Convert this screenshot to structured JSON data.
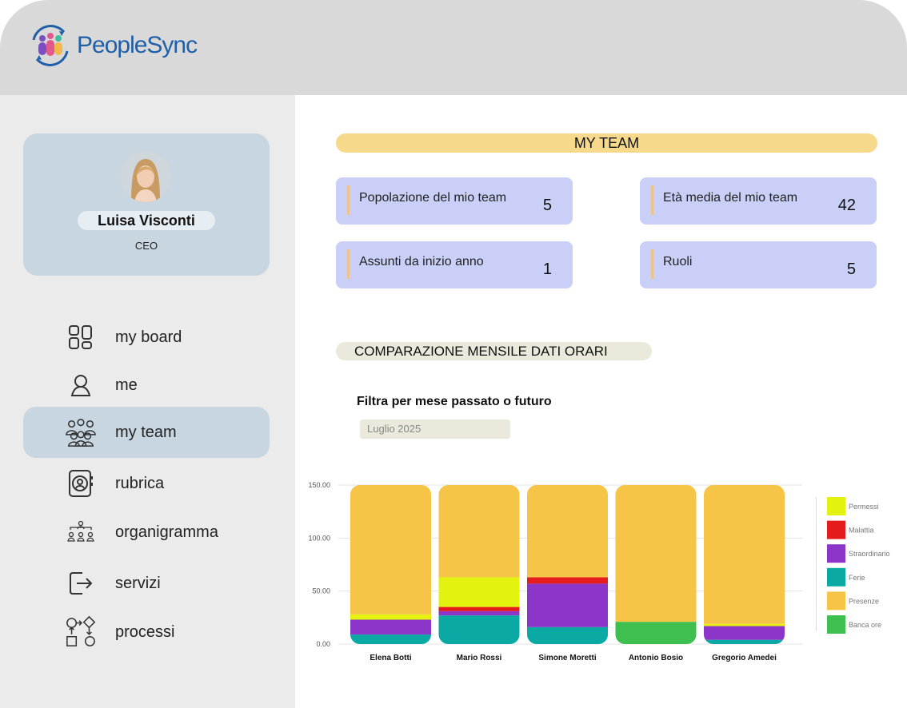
{
  "app": {
    "brand": "PeopleSync"
  },
  "profile": {
    "name": "Luisa Visconti",
    "role": "CEO"
  },
  "nav": [
    {
      "label": "my board",
      "icon": "grid-icon"
    },
    {
      "label": "me",
      "icon": "user-icon"
    },
    {
      "label": "my team",
      "icon": "team-icon",
      "active": true
    },
    {
      "label": "rubrica",
      "icon": "contact-book-icon"
    },
    {
      "label": "organigramma",
      "icon": "org-chart-icon"
    },
    {
      "label": "servizi",
      "icon": "exit-icon"
    },
    {
      "label": "processi",
      "icon": "flow-icon"
    }
  ],
  "team": {
    "title": "MY TEAM",
    "stats": [
      {
        "label": "Popolazione del mio team",
        "value": "5"
      },
      {
        "label": "Età media del mio team",
        "value": "42"
      },
      {
        "label": "Assunti da inizio anno",
        "value": "1"
      },
      {
        "label": "Ruoli",
        "value": "5"
      }
    ]
  },
  "comparison": {
    "title": "COMPARAZIONE MENSILE DATI ORARI",
    "filter_title": "Filtra per mese passato o futuro",
    "filter_value": "Luglio 2025"
  },
  "chart_data": {
    "type": "bar",
    "stacked": true,
    "categories": [
      "Elena Botti",
      "Mario Rossi",
      "Simone Moretti",
      "Antonio Bosio",
      "Gregorio Amedei"
    ],
    "ylim": [
      0,
      150
    ],
    "yticks": [
      "0.00",
      "50.00",
      "100.00",
      "150.00"
    ],
    "grid": true,
    "legend": "right",
    "series": [
      {
        "name": "Banca ore",
        "color": "#3fbf4f",
        "values": [
          0,
          0,
          0,
          21,
          0
        ]
      },
      {
        "name": "Ferie",
        "color": "#0aa9a3",
        "values": [
          9,
          27,
          16,
          0,
          4
        ]
      },
      {
        "name": "Straordinario",
        "color": "#8b35c9",
        "values": [
          14,
          4,
          41,
          0,
          13
        ]
      },
      {
        "name": "Malattia",
        "color": "#e51c1c",
        "values": [
          0,
          4,
          6,
          0,
          0
        ]
      },
      {
        "name": "Permessi",
        "color": "#e3f30f",
        "values": [
          5,
          28,
          0,
          0,
          2
        ]
      },
      {
        "name": "Presenze",
        "color": "#f6c548",
        "values": [
          122,
          87,
          87,
          129,
          131
        ]
      }
    ],
    "legend_order": [
      "Permessi",
      "Malattia",
      "Straordinario",
      "Ferie",
      "Presenze",
      "Banca ore"
    ]
  }
}
